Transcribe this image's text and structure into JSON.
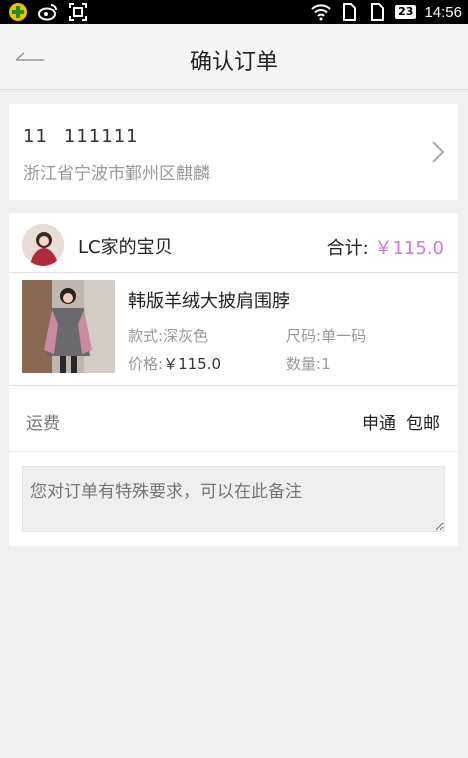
{
  "status_bar": {
    "icons": [
      "app-badge-icon",
      "weibo-icon",
      "scan-icon",
      "wifi-icon",
      "sim1-icon",
      "sim2-icon"
    ],
    "battery": "23",
    "time": "14:56"
  },
  "header": {
    "title": "确认订单",
    "back_icon": "back-arrow-icon"
  },
  "address": {
    "name": "11",
    "phone": "111111",
    "location": "浙江省宁波市鄞州区麒麟"
  },
  "shop": {
    "name": "LC家的宝贝",
    "total_label": "合计:",
    "total_value": "￥115.0"
  },
  "item": {
    "title": "韩版羊绒大披肩围脖",
    "style_label": "款式:",
    "style_value": "深灰色",
    "size_label": "尺码:",
    "size_value": "单一码",
    "price_label": "价格:",
    "price_value": "￥115.0",
    "qty_label": "数量:",
    "qty_value": "1"
  },
  "shipping": {
    "label": "运费",
    "carrier": "申通",
    "policy": "包邮"
  },
  "remark": {
    "placeholder": "您对订单有特殊要求，可以在此备注"
  },
  "colors": {
    "accent": "#c77ad6",
    "statusbar": "#000000",
    "background": "#f0f0f0"
  }
}
